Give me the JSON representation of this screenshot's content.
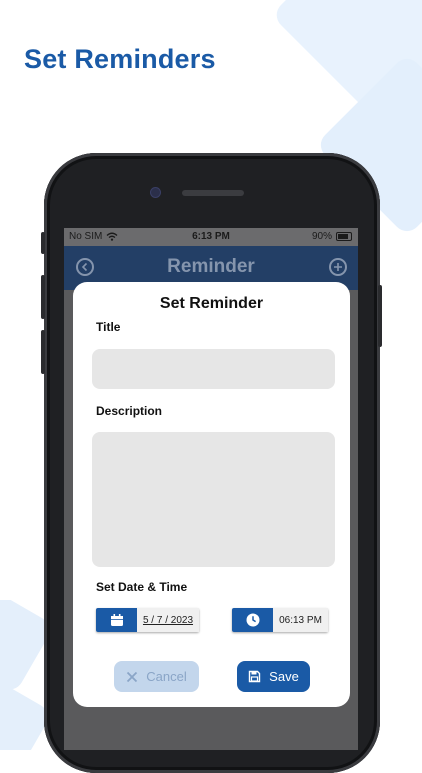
{
  "headline": "Set Reminders",
  "status_bar": {
    "carrier": "No SIM",
    "time": "6:13 PM",
    "battery": "90%"
  },
  "app_bar": {
    "title": "Reminder",
    "back_icon": "back-circle-icon",
    "add_icon": "add-circle-icon"
  },
  "modal": {
    "title": "Set Reminder",
    "title_label": "Title",
    "title_value": "",
    "description_label": "Description",
    "description_value": "",
    "datetime_label": "Set Date & Time",
    "date_value": "5 / 7 / 2023",
    "time_value": "06:13 PM",
    "date_icon": "calendar-icon",
    "time_icon": "clock-icon",
    "cancel_label": "Cancel",
    "save_label": "Save"
  },
  "colors": {
    "brand": "#1a5aa6",
    "field_bg": "#e6e6e6",
    "cancel_bg": "#c3d6ec"
  }
}
